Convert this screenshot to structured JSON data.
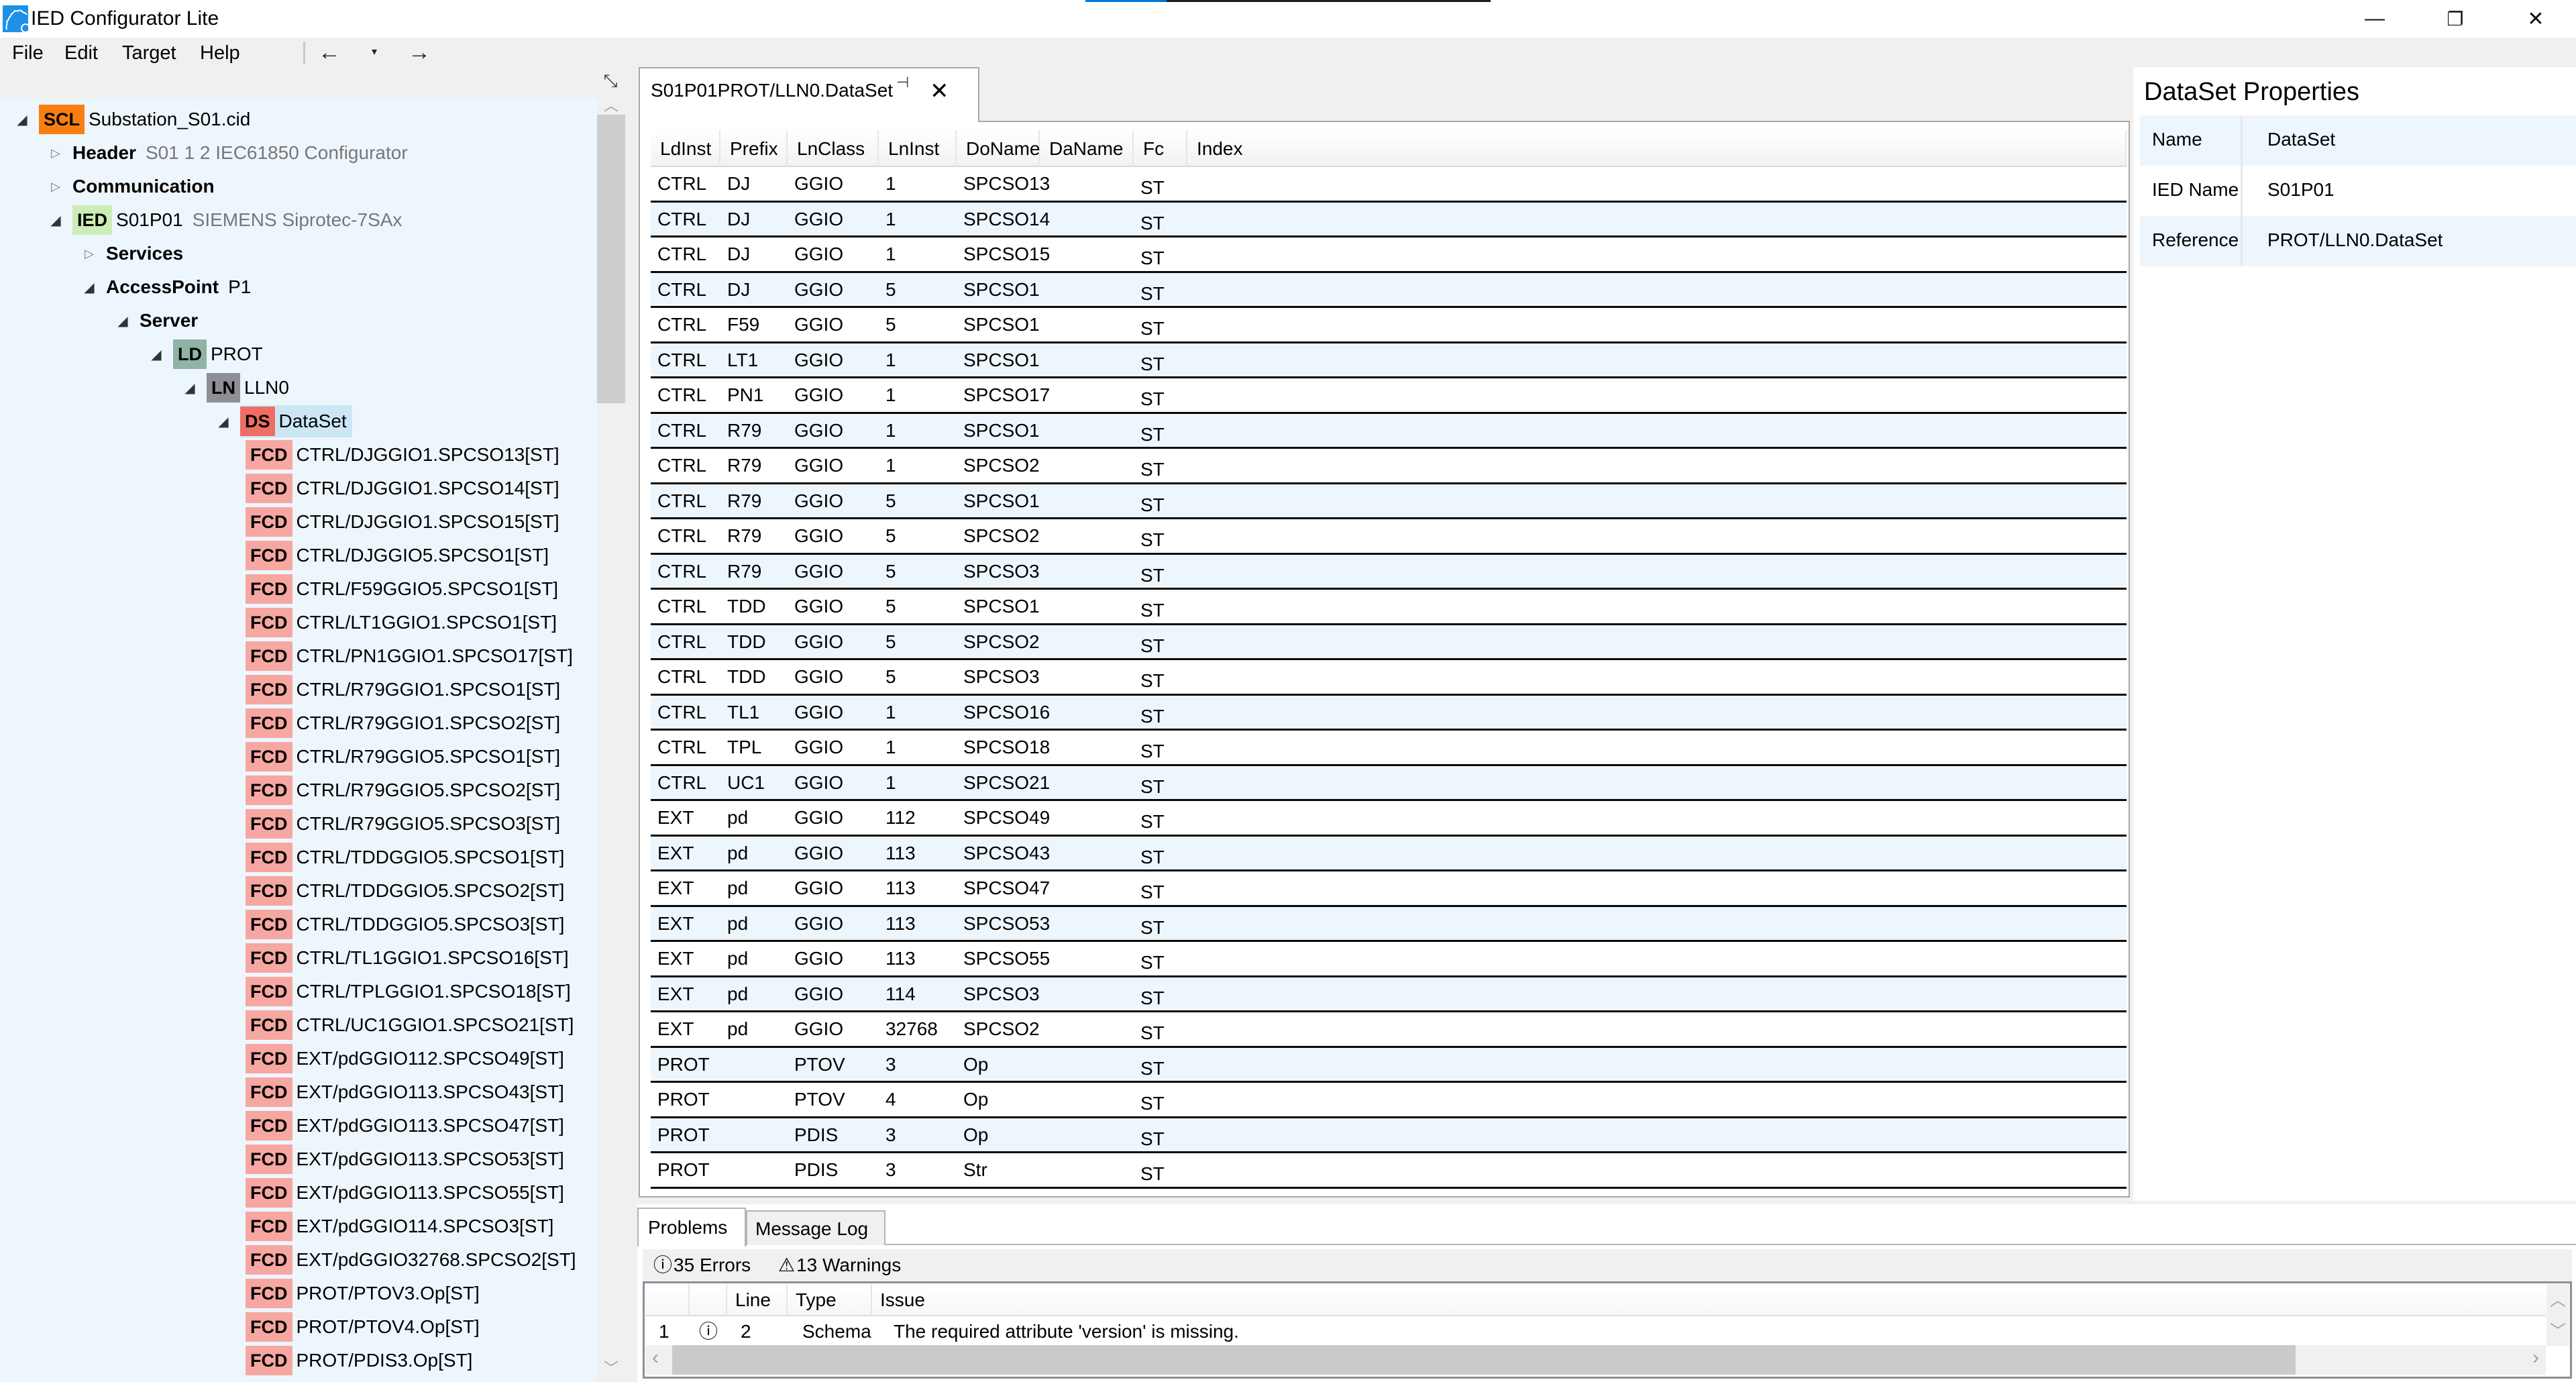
{
  "window": {
    "title": "IED Configurator Lite",
    "app_icon": "gear-icon",
    "activity_progress": 0.2,
    "controls": {
      "minimize": "—",
      "restore": "❐",
      "close": "✕"
    }
  },
  "menu": {
    "items": [
      "File",
      "Edit",
      "Target",
      "Help"
    ],
    "back": "←",
    "history": "▾",
    "forward": "→"
  },
  "tree": {
    "collapse_glyph": "⤡",
    "nodes": [
      {
        "level": 0,
        "toggle": "open",
        "badge": "SCL",
        "badge_kind": "scl",
        "name": "Substation_S01.cid",
        "bold": false,
        "sub": ""
      },
      {
        "level": 1,
        "toggle": "closed",
        "badge": "",
        "badge_kind": "",
        "name": "Header",
        "bold": true,
        "sub": "S01 1 2 IEC61850 Configurator"
      },
      {
        "level": 1,
        "toggle": "closed",
        "badge": "",
        "badge_kind": "",
        "name": "Communication",
        "bold": true,
        "sub": ""
      },
      {
        "level": 1,
        "toggle": "open",
        "badge": "IED",
        "badge_kind": "ied",
        "name": "S01P01",
        "bold": false,
        "sub": "SIEMENS Siprotec-7SAx"
      },
      {
        "level": 2,
        "toggle": "closed",
        "badge": "",
        "badge_kind": "",
        "name": "Services",
        "bold": true,
        "sub": ""
      },
      {
        "level": 2,
        "toggle": "open",
        "badge": "",
        "badge_kind": "",
        "name": "AccessPoint",
        "bold": true,
        "val": "P1",
        "sub": ""
      },
      {
        "level": 3,
        "toggle": "open",
        "badge": "",
        "badge_kind": "",
        "name": "Server",
        "bold": true,
        "sub": ""
      },
      {
        "level": 4,
        "toggle": "open",
        "badge": "LD",
        "badge_kind": "ld",
        "name": "PROT",
        "bold": false,
        "sub": ""
      },
      {
        "level": 5,
        "toggle": "open",
        "badge": "LN",
        "badge_kind": "ln",
        "name": "LLN0",
        "bold": false,
        "sub": ""
      },
      {
        "level": 6,
        "toggle": "open",
        "badge": "DS",
        "badge_kind": "ds",
        "name": "DataSet",
        "bold": false,
        "sub": "",
        "selected": true
      }
    ],
    "fcd_badge": "FCD",
    "fcd_items": [
      "CTRL/DJGGIO1.SPCSO13[ST]",
      "CTRL/DJGGIO1.SPCSO14[ST]",
      "CTRL/DJGGIO1.SPCSO15[ST]",
      "CTRL/DJGGIO5.SPCSO1[ST]",
      "CTRL/F59GGIO5.SPCSO1[ST]",
      "CTRL/LT1GGIO1.SPCSO1[ST]",
      "CTRL/PN1GGIO1.SPCSO17[ST]",
      "CTRL/R79GGIO1.SPCSO1[ST]",
      "CTRL/R79GGIO1.SPCSO2[ST]",
      "CTRL/R79GGIO5.SPCSO1[ST]",
      "CTRL/R79GGIO5.SPCSO2[ST]",
      "CTRL/R79GGIO5.SPCSO3[ST]",
      "CTRL/TDDGGIO5.SPCSO1[ST]",
      "CTRL/TDDGGIO5.SPCSO2[ST]",
      "CTRL/TDDGGIO5.SPCSO3[ST]",
      "CTRL/TL1GGIO1.SPCSO16[ST]",
      "CTRL/TPLGGIO1.SPCSO18[ST]",
      "CTRL/UC1GGIO1.SPCSO21[ST]",
      "EXT/pdGGIO112.SPCSO49[ST]",
      "EXT/pdGGIO113.SPCSO43[ST]",
      "EXT/pdGGIO113.SPCSO47[ST]",
      "EXT/pdGGIO113.SPCSO53[ST]",
      "EXT/pdGGIO113.SPCSO55[ST]",
      "EXT/pdGGIO114.SPCSO3[ST]",
      "EXT/pdGGIO32768.SPCSO2[ST]",
      "PROT/PTOV3.Op[ST]",
      "PROT/PTOV4.Op[ST]",
      "PROT/PDIS3.Op[ST]"
    ]
  },
  "document": {
    "tab_label": "S01P01PROT/LLN0.DataSet",
    "pin_glyph": "⊣",
    "close_glyph": "✕",
    "columns": [
      "LdInst",
      "Prefix",
      "LnClass",
      "LnInst",
      "DoName",
      "DaName",
      "Fc",
      "Index"
    ],
    "rows": [
      [
        "CTRL",
        "DJ",
        "GGIO",
        "1",
        "SPCSO13",
        "",
        "ST",
        ""
      ],
      [
        "CTRL",
        "DJ",
        "GGIO",
        "1",
        "SPCSO14",
        "",
        "ST",
        ""
      ],
      [
        "CTRL",
        "DJ",
        "GGIO",
        "1",
        "SPCSO15",
        "",
        "ST",
        ""
      ],
      [
        "CTRL",
        "DJ",
        "GGIO",
        "5",
        "SPCSO1",
        "",
        "ST",
        ""
      ],
      [
        "CTRL",
        "F59",
        "GGIO",
        "5",
        "SPCSO1",
        "",
        "ST",
        ""
      ],
      [
        "CTRL",
        "LT1",
        "GGIO",
        "1",
        "SPCSO1",
        "",
        "ST",
        ""
      ],
      [
        "CTRL",
        "PN1",
        "GGIO",
        "1",
        "SPCSO17",
        "",
        "ST",
        ""
      ],
      [
        "CTRL",
        "R79",
        "GGIO",
        "1",
        "SPCSO1",
        "",
        "ST",
        ""
      ],
      [
        "CTRL",
        "R79",
        "GGIO",
        "1",
        "SPCSO2",
        "",
        "ST",
        ""
      ],
      [
        "CTRL",
        "R79",
        "GGIO",
        "5",
        "SPCSO1",
        "",
        "ST",
        ""
      ],
      [
        "CTRL",
        "R79",
        "GGIO",
        "5",
        "SPCSO2",
        "",
        "ST",
        ""
      ],
      [
        "CTRL",
        "R79",
        "GGIO",
        "5",
        "SPCSO3",
        "",
        "ST",
        ""
      ],
      [
        "CTRL",
        "TDD",
        "GGIO",
        "5",
        "SPCSO1",
        "",
        "ST",
        ""
      ],
      [
        "CTRL",
        "TDD",
        "GGIO",
        "5",
        "SPCSO2",
        "",
        "ST",
        ""
      ],
      [
        "CTRL",
        "TDD",
        "GGIO",
        "5",
        "SPCSO3",
        "",
        "ST",
        ""
      ],
      [
        "CTRL",
        "TL1",
        "GGIO",
        "1",
        "SPCSO16",
        "",
        "ST",
        ""
      ],
      [
        "CTRL",
        "TPL",
        "GGIO",
        "1",
        "SPCSO18",
        "",
        "ST",
        ""
      ],
      [
        "CTRL",
        "UC1",
        "GGIO",
        "1",
        "SPCSO21",
        "",
        "ST",
        ""
      ],
      [
        "EXT",
        "pd",
        "GGIO",
        "112",
        "SPCSO49",
        "",
        "ST",
        ""
      ],
      [
        "EXT",
        "pd",
        "GGIO",
        "113",
        "SPCSO43",
        "",
        "ST",
        ""
      ],
      [
        "EXT",
        "pd",
        "GGIO",
        "113",
        "SPCSO47",
        "",
        "ST",
        ""
      ],
      [
        "EXT",
        "pd",
        "GGIO",
        "113",
        "SPCSO53",
        "",
        "ST",
        ""
      ],
      [
        "EXT",
        "pd",
        "GGIO",
        "113",
        "SPCSO55",
        "",
        "ST",
        ""
      ],
      [
        "EXT",
        "pd",
        "GGIO",
        "114",
        "SPCSO3",
        "",
        "ST",
        ""
      ],
      [
        "EXT",
        "pd",
        "GGIO",
        "32768",
        "SPCSO2",
        "",
        "ST",
        ""
      ],
      [
        "PROT",
        "",
        "PTOV",
        "3",
        "Op",
        "",
        "ST",
        ""
      ],
      [
        "PROT",
        "",
        "PTOV",
        "4",
        "Op",
        "",
        "ST",
        ""
      ],
      [
        "PROT",
        "",
        "PDIS",
        "3",
        "Op",
        "",
        "ST",
        ""
      ],
      [
        "PROT",
        "",
        "PDIS",
        "3",
        "Str",
        "",
        "ST",
        ""
      ]
    ]
  },
  "properties": {
    "title": "DataSet Properties",
    "rows": [
      {
        "key": "Name",
        "value": "DataSet"
      },
      {
        "key": "IED Name",
        "value": "S01P01"
      },
      {
        "key": "Reference",
        "value": "PROT/LLN0.DataSet"
      }
    ]
  },
  "bottom": {
    "tabs": [
      "Problems",
      "Message Log"
    ],
    "active_tab": "Problems",
    "errors_icon": "ⓘ",
    "errors_label": "35 Errors",
    "warnings_icon": "⚠",
    "warnings_label": "13 Warnings",
    "columns": [
      "",
      "",
      "Line",
      "Type",
      "Issue"
    ],
    "rows": [
      {
        "index": "1",
        "icon": "ⓘ",
        "line": "2",
        "type": "Schema",
        "issue": "The required attribute 'version' is missing."
      }
    ]
  },
  "colors": {
    "accent": "#0078d7",
    "tree_bg": "#eef6fd",
    "row_alt": "#eef6fd",
    "scl": "#f97e12",
    "ied": "#cdecb6",
    "ld": "#8fb3a4",
    "ln": "#8e8e94",
    "ds": "#ef6e64",
    "fcd": "#f6a7a1",
    "selection": "#cce6f6"
  }
}
